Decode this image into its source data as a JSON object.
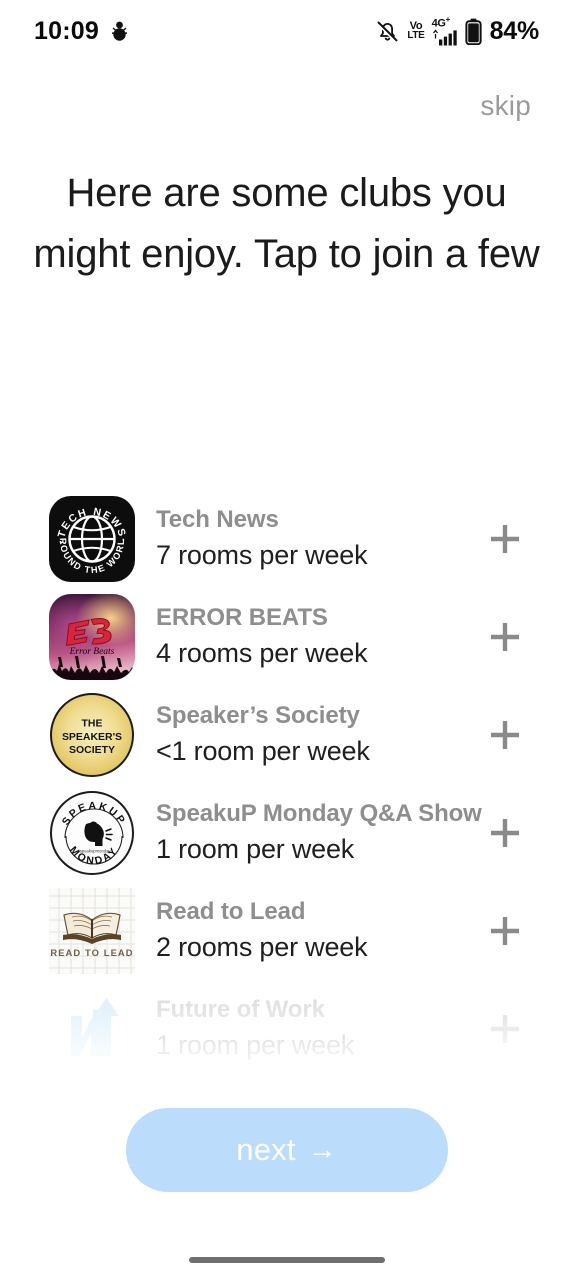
{
  "status_bar": {
    "time": "10:09",
    "left_icons": [
      "snowman-icon"
    ],
    "right_icons": [
      "notifications-muted-icon",
      "volte-icon",
      "signal-4g-icon",
      "battery-icon"
    ],
    "volte_top": "Vo",
    "volte_bottom": "LTE",
    "network_label": "4G",
    "battery_percent": "84%"
  },
  "header": {
    "skip_label": "skip",
    "title": "Here are some clubs you might enjoy. Tap to join a few"
  },
  "clubs": [
    {
      "name": "Tech News",
      "rooms": "7 rooms per week",
      "logo": "tech-news-globe-logo",
      "logo_text_top": "·TECH NEWS·",
      "logo_text_bottom": "AROUND THE WORLD",
      "action": "+",
      "faded": false
    },
    {
      "name": "ERROR BEATS",
      "rooms": "4 rooms per week",
      "logo": "error-beats-concert-logo",
      "logo_text_top": "EB",
      "logo_text_bottom": "Error Beats",
      "action": "+",
      "faded": false
    },
    {
      "name": "Speaker’s Society",
      "rooms": "<1 room per week",
      "logo": "speakers-society-badge-logo",
      "logo_text_top": "THE",
      "logo_text_mid": "SPEAKER'S",
      "logo_text_bottom": "SOCIETY",
      "action": "+",
      "faded": false
    },
    {
      "name": "SpeakuP Monday Q&A Show",
      "rooms": "1 room per week",
      "logo": "speakup-monday-head-logo",
      "logo_text_top": "SPEAKUP",
      "logo_text_bottom": "MONDAY",
      "action": "+",
      "faded": false
    },
    {
      "name": "Read to Lead",
      "rooms": "2 rooms per week",
      "logo": "read-to-lead-book-logo",
      "logo_text_bottom": "READ TO LEAD",
      "action": "+",
      "faded": false
    },
    {
      "name": "Future of Work",
      "rooms": "1 room per week",
      "logo": "future-of-work-arrow-logo",
      "action": "+",
      "faded": true
    }
  ],
  "footer": {
    "next_label": "next",
    "next_arrow": "→"
  },
  "colors": {
    "accent_button": "#bcdcfb",
    "club_name": "#8e8e8e",
    "club_rooms": "#1f1f1f",
    "skip": "#9a9a9a",
    "plus": "#8a8a8a",
    "title": "#1b1b1b"
  }
}
